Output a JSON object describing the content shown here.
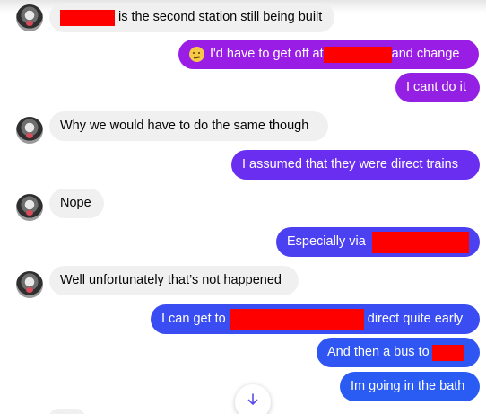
{
  "colors": {
    "incoming": "#f0f0f0",
    "redaction": "#ff0000"
  },
  "messages": [
    {
      "text": "is the second station still being built"
    },
    {
      "before": "I'd have to get off at",
      "after": "and change",
      "emoji": "confused-face-icon"
    },
    {
      "text": "I cant do it"
    },
    {
      "text": "Why we would have to do the same though"
    },
    {
      "text": "I assumed that they were direct trains"
    },
    {
      "text": "Nope"
    },
    {
      "text": "Especially via"
    },
    {
      "text": "Well unfortunately that’s not happened"
    },
    {
      "before": "I can get to",
      "after": "direct quite early"
    },
    {
      "text": "And then a bus to"
    },
    {
      "text": "Im going in the bath"
    }
  ],
  "scroll_button": {
    "icon": "arrow-down-icon"
  }
}
